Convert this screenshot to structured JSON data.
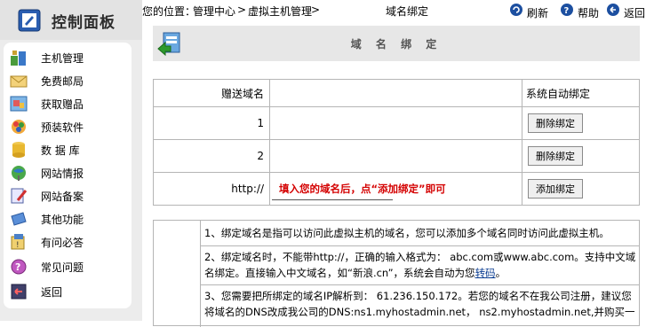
{
  "sidebar": {
    "title": "控制面板",
    "items": [
      {
        "label": "主机管理",
        "icon": "server-icon"
      },
      {
        "label": "免费邮局",
        "icon": "mail-icon"
      },
      {
        "label": "获取赠品",
        "icon": "gift-icon"
      },
      {
        "label": "预装软件",
        "icon": "software-icon"
      },
      {
        "label": "数 据 库",
        "icon": "database-icon"
      },
      {
        "label": "网站情报",
        "icon": "globe-icon"
      },
      {
        "label": "网站备案",
        "icon": "record-icon"
      },
      {
        "label": "其他功能",
        "icon": "tools-icon"
      },
      {
        "label": "有问必答",
        "icon": "qa-icon"
      },
      {
        "label": "常见问题",
        "icon": "faq-icon"
      },
      {
        "label": "返回",
        "icon": "return-icon"
      }
    ]
  },
  "topbar": {
    "location_prefix": "您的位置：",
    "crumb_1": "管理中心",
    "crumb_sep": ">",
    "crumb_2": "虚拟主机管理",
    "page_name": "域名绑定",
    "refresh": "刷新",
    "help": "帮助",
    "back": "返回"
  },
  "main": {
    "title": "域 名 绑 定",
    "table": {
      "header_label": "赠送域名",
      "header_action": "系统自动绑定",
      "rows": [
        {
          "label": "1",
          "value": "",
          "button": "删除绑定"
        },
        {
          "label": "2",
          "value": "",
          "button": "删除绑定"
        },
        {
          "label": "http://",
          "hint": "填入您的域名后，点“添加绑定”即可",
          "button": "添加绑定"
        }
      ]
    },
    "notes": [
      "1、绑定域名是指可以访问此虚拟主机的域名，您可以添加多个域名同时访问此虚拟主机。",
      "2、绑定域名时，不能带http://，正确的输入格式为： abc.com或www.abc.com。支持中文域名绑定。直接输入中文域名，如“新浪.cn”，系统会自动为您",
      "转码",
      "。",
      "3、您需要把所绑定的域名IP解析到： 61.236.150.172。若您的域名不在我公司注册，建议您将域名的DNS改成我公司的DNS:ns1.myhostadmin.net，  ns2.myhostadmin.net,并购买一"
    ]
  },
  "colors": {
    "sidebar_bg": "#ececec",
    "hint_red": "#d40000",
    "border": "#b5b5b5"
  }
}
